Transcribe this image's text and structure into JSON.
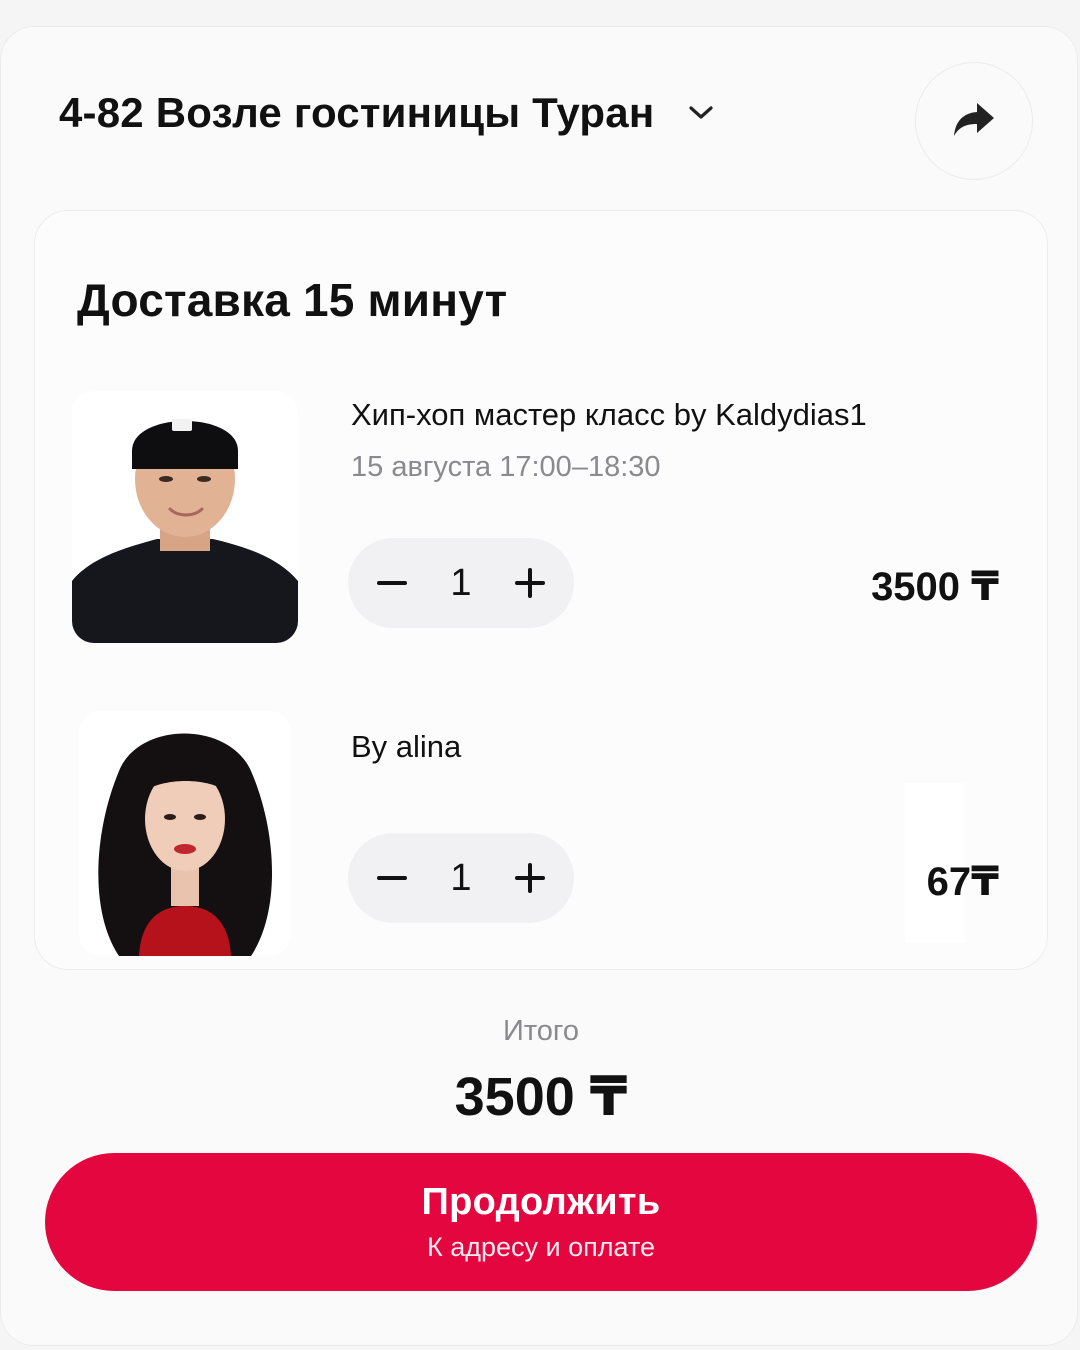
{
  "header": {
    "address": "4-82 Возле гостиницы Туран",
    "chevron_icon": "chevron-down-icon",
    "share_icon": "share-icon"
  },
  "delivery": {
    "title": "Доставка 15 минут",
    "items": [
      {
        "title": "Хип-хоп мастер класс by Kaldydias1",
        "subtitle": "15 августа 17:00–18:30",
        "quantity": "1",
        "price": "3500 ₸",
        "image_icon": "avatar-man-cap"
      },
      {
        "title": "By alina",
        "subtitle": "",
        "quantity": "1",
        "price": "67₸",
        "image_icon": "avatar-woman-curly-hair"
      }
    ],
    "minus_icon": "minus-icon",
    "plus_icon": "plus-icon"
  },
  "summary": {
    "label": "Итого",
    "total": "3500 ₸"
  },
  "cta": {
    "label": "Продолжить",
    "sublabel": "К адресу и оплате",
    "color": "#e3063f"
  }
}
